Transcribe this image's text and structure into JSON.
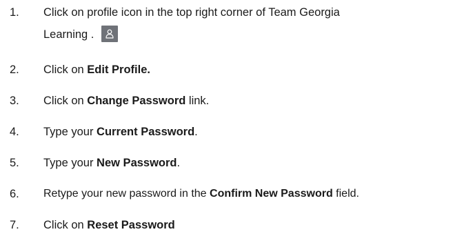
{
  "steps": [
    {
      "number": "1.",
      "line1": "Click on profile icon in the top right corner of Team Georgia",
      "line2": "Learning .",
      "icon": "person-icon"
    },
    {
      "number": "2.",
      "pre": "Click on ",
      "bold": "Edit Profile.",
      "post": ""
    },
    {
      "number": "3.",
      "pre": "Click on ",
      "bold": "Change Password",
      "post": " link."
    },
    {
      "number": "4.",
      "pre": "Type your ",
      "bold": "Current Password",
      "post": "."
    },
    {
      "number": "5.",
      "pre": "Type your ",
      "bold": "New Password",
      "post": "."
    },
    {
      "number": "6.",
      "pre": "Retype your new password in the ",
      "bold": "Confirm New Password",
      "post": " field."
    },
    {
      "number": "7.",
      "pre": "Click on ",
      "bold": "Reset Password",
      "post": ""
    }
  ],
  "colors": {
    "text": "#1a1a1a",
    "icon_bg": "#6f7278"
  }
}
